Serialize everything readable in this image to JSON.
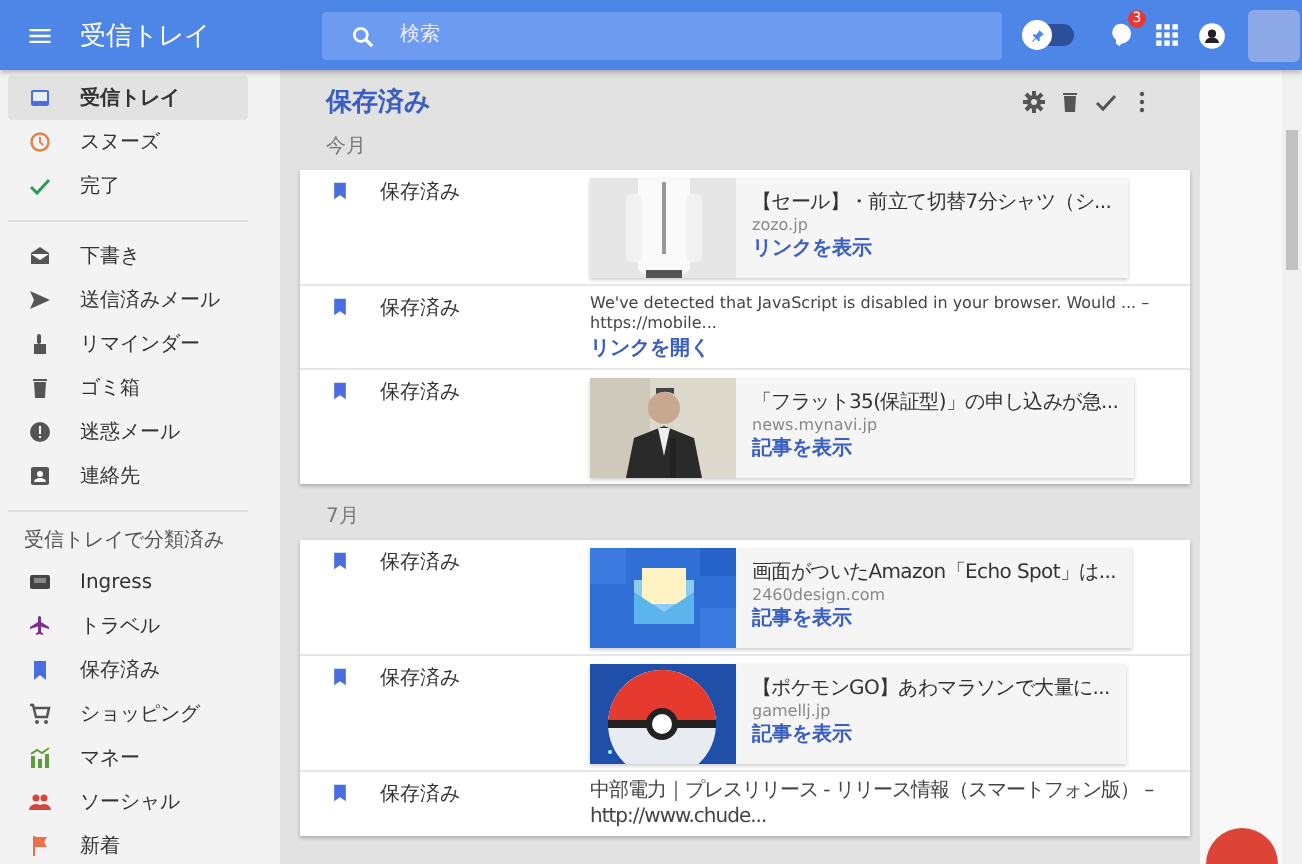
{
  "header": {
    "title": "受信トレイ",
    "search": {
      "placeholder": "検索"
    },
    "pin_toggle": {
      "on": false
    },
    "notifications": {
      "badge": "3"
    }
  },
  "sidebar": {
    "groups": [
      {
        "items": [
          {
            "label": "受信トレイ",
            "selected": true
          },
          {
            "label": "スヌーズ",
            "selected": false
          },
          {
            "label": "完了",
            "selected": false
          }
        ]
      },
      {
        "items": [
          {
            "label": "下書き",
            "selected": false
          },
          {
            "label": "送信済みメール",
            "selected": false
          },
          {
            "label": "リマインダー",
            "selected": false
          },
          {
            "label": "ゴミ箱",
            "selected": false
          },
          {
            "label": "迷惑メール",
            "selected": false
          },
          {
            "label": "連絡先",
            "selected": false
          }
        ]
      },
      {
        "heading": "受信トレイで分類済み",
        "items": [
          {
            "label": "Ingress",
            "selected": false
          },
          {
            "label": "トラベル",
            "selected": false
          },
          {
            "label": "保存済み",
            "selected": false
          },
          {
            "label": "ショッピング",
            "selected": false
          },
          {
            "label": "マネー",
            "selected": false
          },
          {
            "label": "ソーシャル",
            "selected": false
          },
          {
            "label": "新着",
            "selected": false
          }
        ]
      }
    ]
  },
  "main": {
    "title": "保存済み",
    "sections": [
      {
        "heading": "今月",
        "items": [
          {
            "kind": "preview",
            "label": "保存済み",
            "title": "【セール】・前立て切替7分シャツ（シ...",
            "source": "zozo.jp",
            "link": "リンクを表示"
          },
          {
            "kind": "link",
            "label": "保存済み",
            "text": "We've detected that JavaScript is disabled in your browser. Would ... – https://mobile...",
            "link": "リンクを開く"
          },
          {
            "kind": "preview",
            "label": "保存済み",
            "title": "「フラット35(保証型)」の申し込みが急...",
            "source": "news.mynavi.jp",
            "link": "記事を表示"
          }
        ]
      },
      {
        "heading": "7月",
        "items": [
          {
            "kind": "preview",
            "label": "保存済み",
            "title": "画面がついたAmazon「Echo Spot」は...",
            "source": "2460design.com",
            "link": "記事を表示"
          },
          {
            "kind": "preview",
            "label": "保存済み",
            "title": "【ポケモンGO】あわマラソンで大量に...",
            "source": "gamellj.jp",
            "link": "記事を表示"
          },
          {
            "kind": "link",
            "label": "保存済み",
            "text": "中部電力｜プレスリリース - リリース情報（スマートフォン版） – http://www.chude..."
          }
        ]
      }
    ]
  }
}
